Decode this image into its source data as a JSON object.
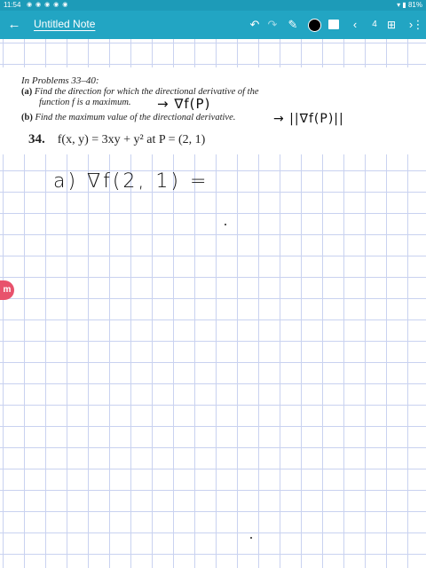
{
  "status_bar": {
    "time": "11:54",
    "battery": "81%"
  },
  "toolbar": {
    "title": "Untitled Note",
    "page_number": "4"
  },
  "document": {
    "intro": "In Problems 33–40:",
    "part_a_label": "(a)",
    "part_a_line1": "Find the direction for which the directional derivative of the",
    "part_a_line2": "function f is a maximum.",
    "part_b_label": "(b)",
    "part_b_line": "Find the maximum value of the directional derivative.",
    "problem_number": "34.",
    "problem_text": "f(x, y) = 3xy + y² at P = (2, 1)"
  },
  "handwriting": {
    "note_a": "→ ∇f(P)",
    "note_b": "→ ||∇f(P)||",
    "work_line": "a)  ∇f(2, 1) ="
  },
  "colors": {
    "toolbar": "#22a5c3",
    "status_bar": "#1d9bb8",
    "grid": "#c9d2f0",
    "logo": "#e8526c"
  }
}
